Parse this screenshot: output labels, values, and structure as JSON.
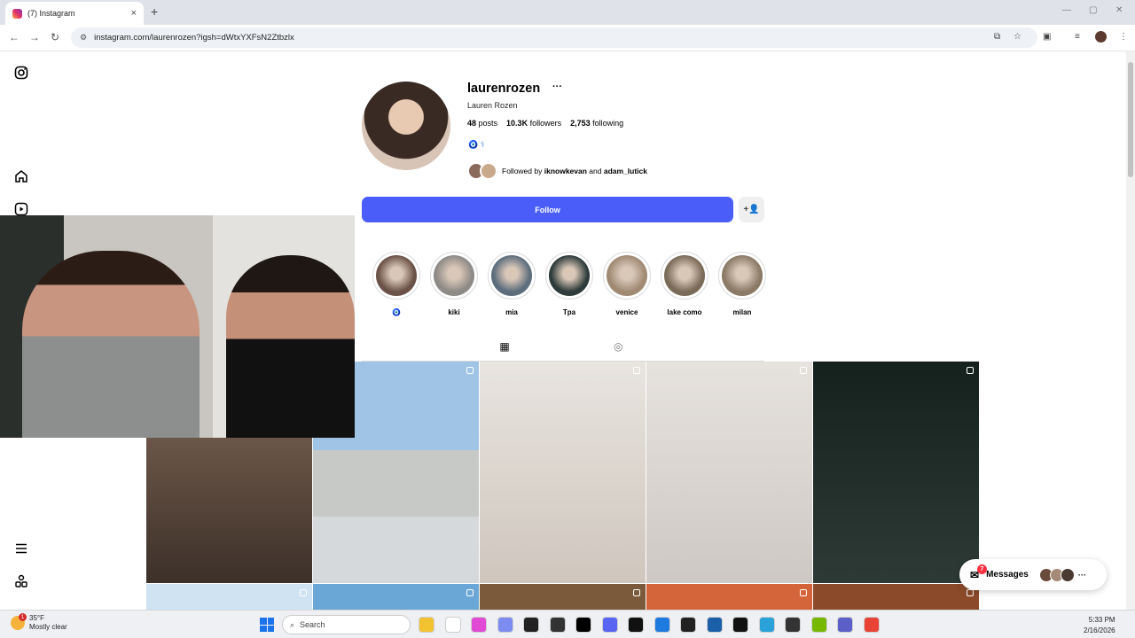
{
  "browser": {
    "tab_title": "(7) Instagram",
    "tab_close": "×",
    "new_tab": "+",
    "url": "instagram.com/laurenrozen?igsh=dWtxYXFsN2Ztbzlx",
    "back": "←",
    "forward": "→",
    "reload": "↻",
    "window_min": "—",
    "window_max": "▢",
    "window_close": "✕"
  },
  "profile": {
    "username": "laurenrozen",
    "more": "···",
    "full_name": "Lauren Rozen",
    "posts_count": "48",
    "posts_label": "posts",
    "followers_count": "10.3K",
    "followers_label": "followers",
    "following_count": "2,753",
    "following_label": "following",
    "bio_icons": "🧿 ⚕",
    "followed_by_prefix": "Followed by",
    "followed_by_user1": "iknowkevan",
    "followed_by_and": "and",
    "followed_by_user2": "adam_lutick"
  },
  "actions": {
    "follow_label": "Follow",
    "suggest_icon": "+👤"
  },
  "highlights": [
    {
      "label": "🧿",
      "color": "#6b5248"
    },
    {
      "label": "kiki",
      "color": "#8e8a86"
    },
    {
      "label": "mia",
      "color": "#5d6d7c"
    },
    {
      "label": "Tpa",
      "color": "#2e3b3a"
    },
    {
      "label": "venice",
      "color": "#a08a74"
    },
    {
      "label": "lake como",
      "color": "#7a6a58"
    },
    {
      "label": "milan",
      "color": "#8a7a66"
    }
  ],
  "tabs": {
    "grid_icon": "▦",
    "tagged_icon": "◎"
  },
  "messages": {
    "label": "Messages",
    "badge": "7",
    "more": "···"
  },
  "taskbar": {
    "temperature": "35°F",
    "condition": "Mostly clear",
    "weather_badge": "1",
    "search_placeholder": "Search",
    "time": "5:33 PM",
    "date": "2/16/2026"
  },
  "colors": {
    "follow_button": "#4a5df9",
    "accent_badge": "#ff3040"
  }
}
